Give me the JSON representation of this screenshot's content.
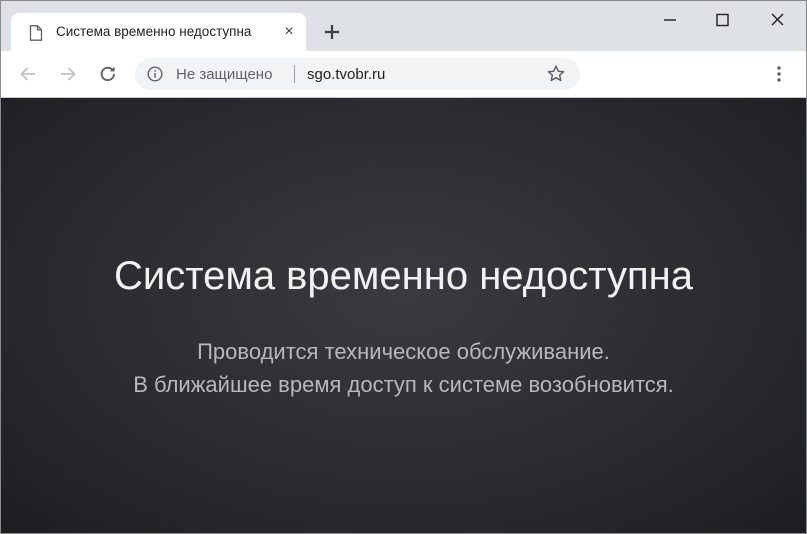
{
  "browser": {
    "tab": {
      "title": "Система временно недоступна",
      "favicon": "document-icon",
      "close_glyph": "×"
    },
    "new_tab_icon": "plus-icon",
    "window_controls": [
      "minimize-icon",
      "maximize-icon",
      "close-icon"
    ],
    "toolbar": {
      "back_icon": "arrow-left-icon",
      "forward_icon": "arrow-right-icon",
      "reload_icon": "reload-icon",
      "menu_icon": "vertical-dots-icon"
    },
    "omnibox": {
      "security_icon": "info-icon",
      "security_label": "Не защищено",
      "url": "sgo.tvobr.ru",
      "bookmark_icon": "star-icon"
    }
  },
  "page": {
    "headline": "Система временно недоступна",
    "message_line_1": "Проводится техническое обслуживание.",
    "message_line_2": "В ближайшее время доступ к системе возобновится."
  },
  "colors": {
    "tabstrip_background": "#dee1e6",
    "page_background": "#2c2d31",
    "headline_text": "#f2f2f2",
    "message_text": "#b8b8bb"
  }
}
